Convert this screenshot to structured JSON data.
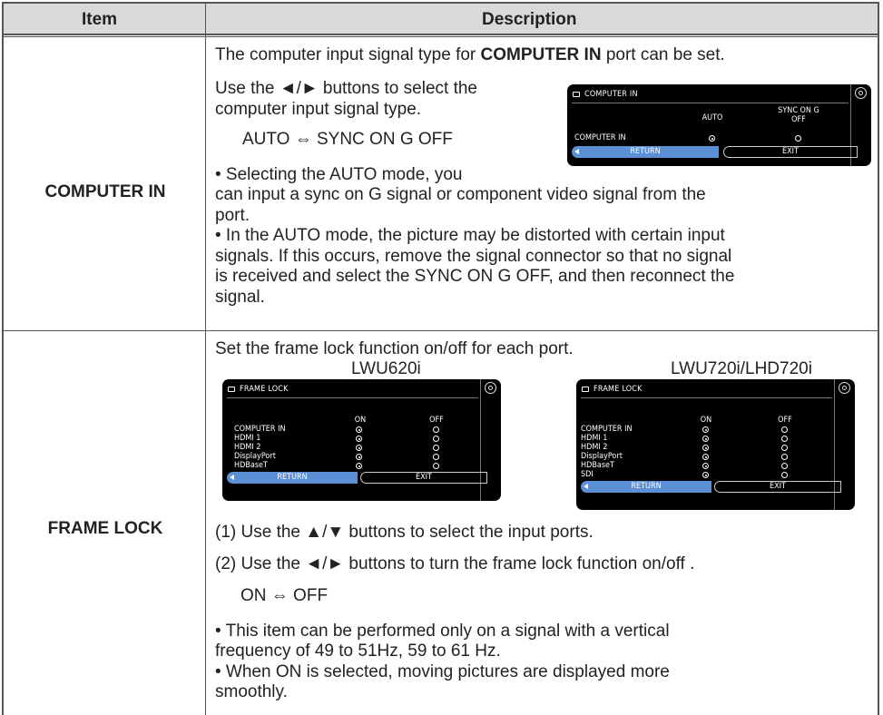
{
  "header": {
    "item": "Item",
    "description": "Description"
  },
  "computer_in": {
    "item": "COMPUTER IN",
    "line1_pre": "The computer input signal type for ",
    "line1_bold": "COMPUTER IN",
    "line1_post": " port can be set.",
    "line2": "Use the ◄/► buttons to select the",
    "line3": "computer input signal type.",
    "line4": "AUTO ⇔ SYNC ON G OFF",
    "line5": "• Selecting the AUTO mode, you",
    "line6": "can input a sync on G signal or component video signal from the",
    "line7": "port.",
    "line8": "• In the AUTO mode, the picture may be distorted with certain input",
    "line9": "signals. If this occurs, remove the signal connector so that no signal",
    "line10": "is received and select the SYNC ON G OFF, and then reconnect the",
    "line11": "signal.",
    "osd": {
      "title": "COMPUTER IN",
      "col_auto": "AUTO",
      "col_sync_1": "SYNC ON G",
      "col_sync_2": "OFF",
      "row_label": "COMPUTER IN",
      "return": "RETURN",
      "exit": "EXIT"
    }
  },
  "frame_lock": {
    "item": "FRAME LOCK",
    "line1": "Set the frame lock function on/off for each port.",
    "model_a": "LWU620i",
    "model_b": "LWU720i/LHD720i",
    "step1": "(1) Use the ▲/▼ buttons to select the input ports.",
    "step2": "(2) Use the ◄/► buttons to turn the frame lock function on/off .",
    "toggle": "ON ⇔ OFF",
    "note1": "• This item can be performed only on a signal with a vertical",
    "note2": "frequency of 49 to 51Hz, 59 to 61 Hz.",
    "note3": "• When ON is selected, moving pictures are displayed more",
    "note4": "smoothly.",
    "osd_a": {
      "title": "FRAME LOCK",
      "on": "ON",
      "off": "OFF",
      "rows": [
        "COMPUTER IN",
        "HDMI 1",
        "HDMI 2",
        "DisplayPort",
        "HDBaseT"
      ],
      "return": "RETURN",
      "exit": "EXIT"
    },
    "osd_b": {
      "title": "FRAME LOCK",
      "on": "ON",
      "off": "OFF",
      "rows": [
        "COMPUTER IN",
        "HDMI 1",
        "HDMI 2",
        "DisplayPort",
        "HDBaseT",
        "SDI"
      ],
      "return": "RETURN",
      "exit": "EXIT"
    }
  }
}
